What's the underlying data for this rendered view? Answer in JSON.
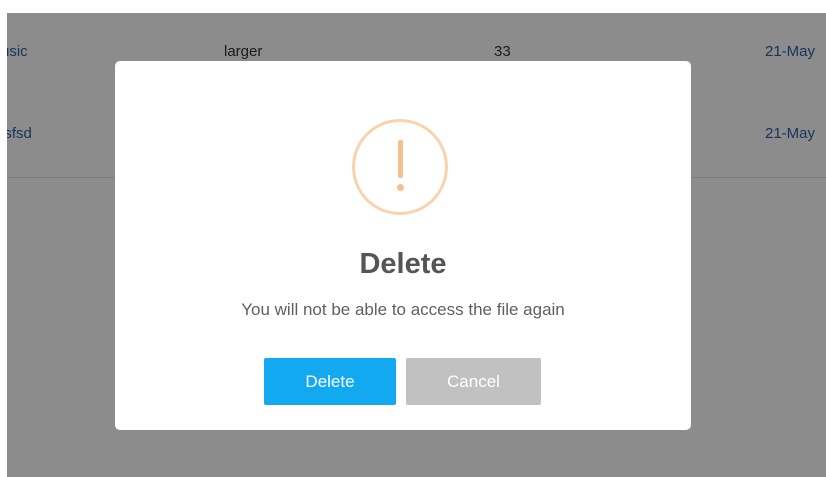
{
  "table": {
    "rows": [
      {
        "name": "usic",
        "type": "larger",
        "size": "33",
        "date": "21-May"
      },
      {
        "name": "lsfsd",
        "type": "",
        "size": "",
        "date": "21-May"
      }
    ]
  },
  "dialog": {
    "icon": "exclamation-icon",
    "title": "Delete",
    "message": "You will not be able to access the file again",
    "confirm_label": "Delete",
    "cancel_label": "Cancel"
  },
  "colors": {
    "overlay": "rgba(0,0,0,0.45)",
    "confirm_button": "#12a9f0",
    "cancel_button": "#c1c1c1",
    "warning_icon": "#f5c08d",
    "link_text": "#2d5ea8"
  }
}
